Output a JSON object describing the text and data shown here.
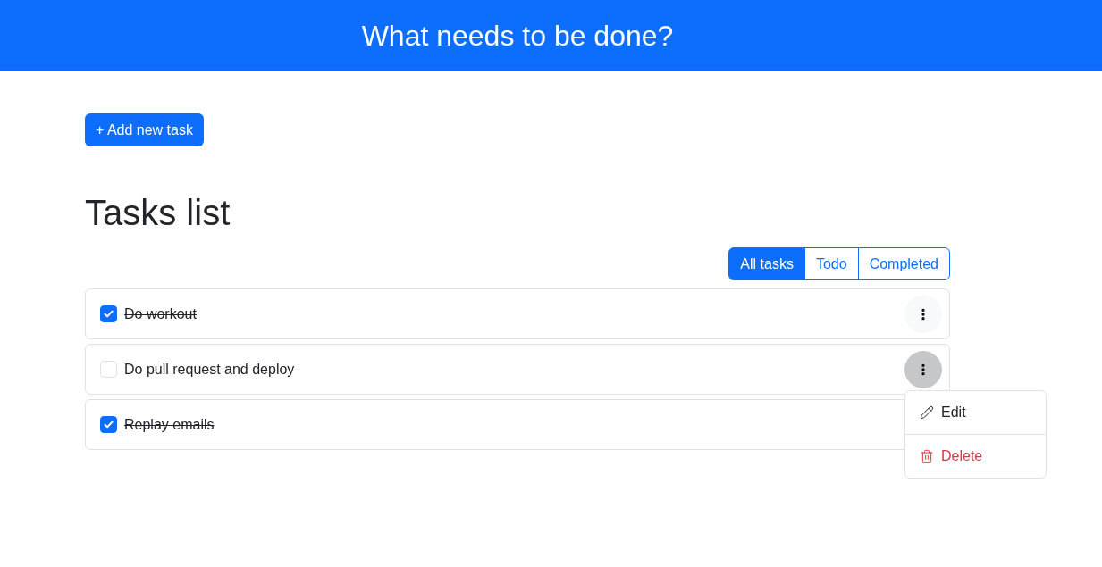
{
  "header": {
    "title": "What needs to be done?"
  },
  "add_button": {
    "label": "+ Add new task"
  },
  "heading": "Tasks list",
  "filters": [
    {
      "label": "All tasks",
      "selected": true
    },
    {
      "label": "Todo",
      "selected": false
    },
    {
      "label": "Completed",
      "selected": false
    }
  ],
  "tasks": [
    {
      "title": "Do workout",
      "checked": true,
      "menu_open": false
    },
    {
      "title": "Do pull request and deploy",
      "checked": false,
      "menu_open": true
    },
    {
      "title": "Replay emails",
      "checked": true,
      "menu_open": false
    }
  ],
  "menu": {
    "items": [
      {
        "kind": "edit",
        "label": "Edit"
      },
      {
        "kind": "delete",
        "label": "Delete"
      }
    ]
  }
}
